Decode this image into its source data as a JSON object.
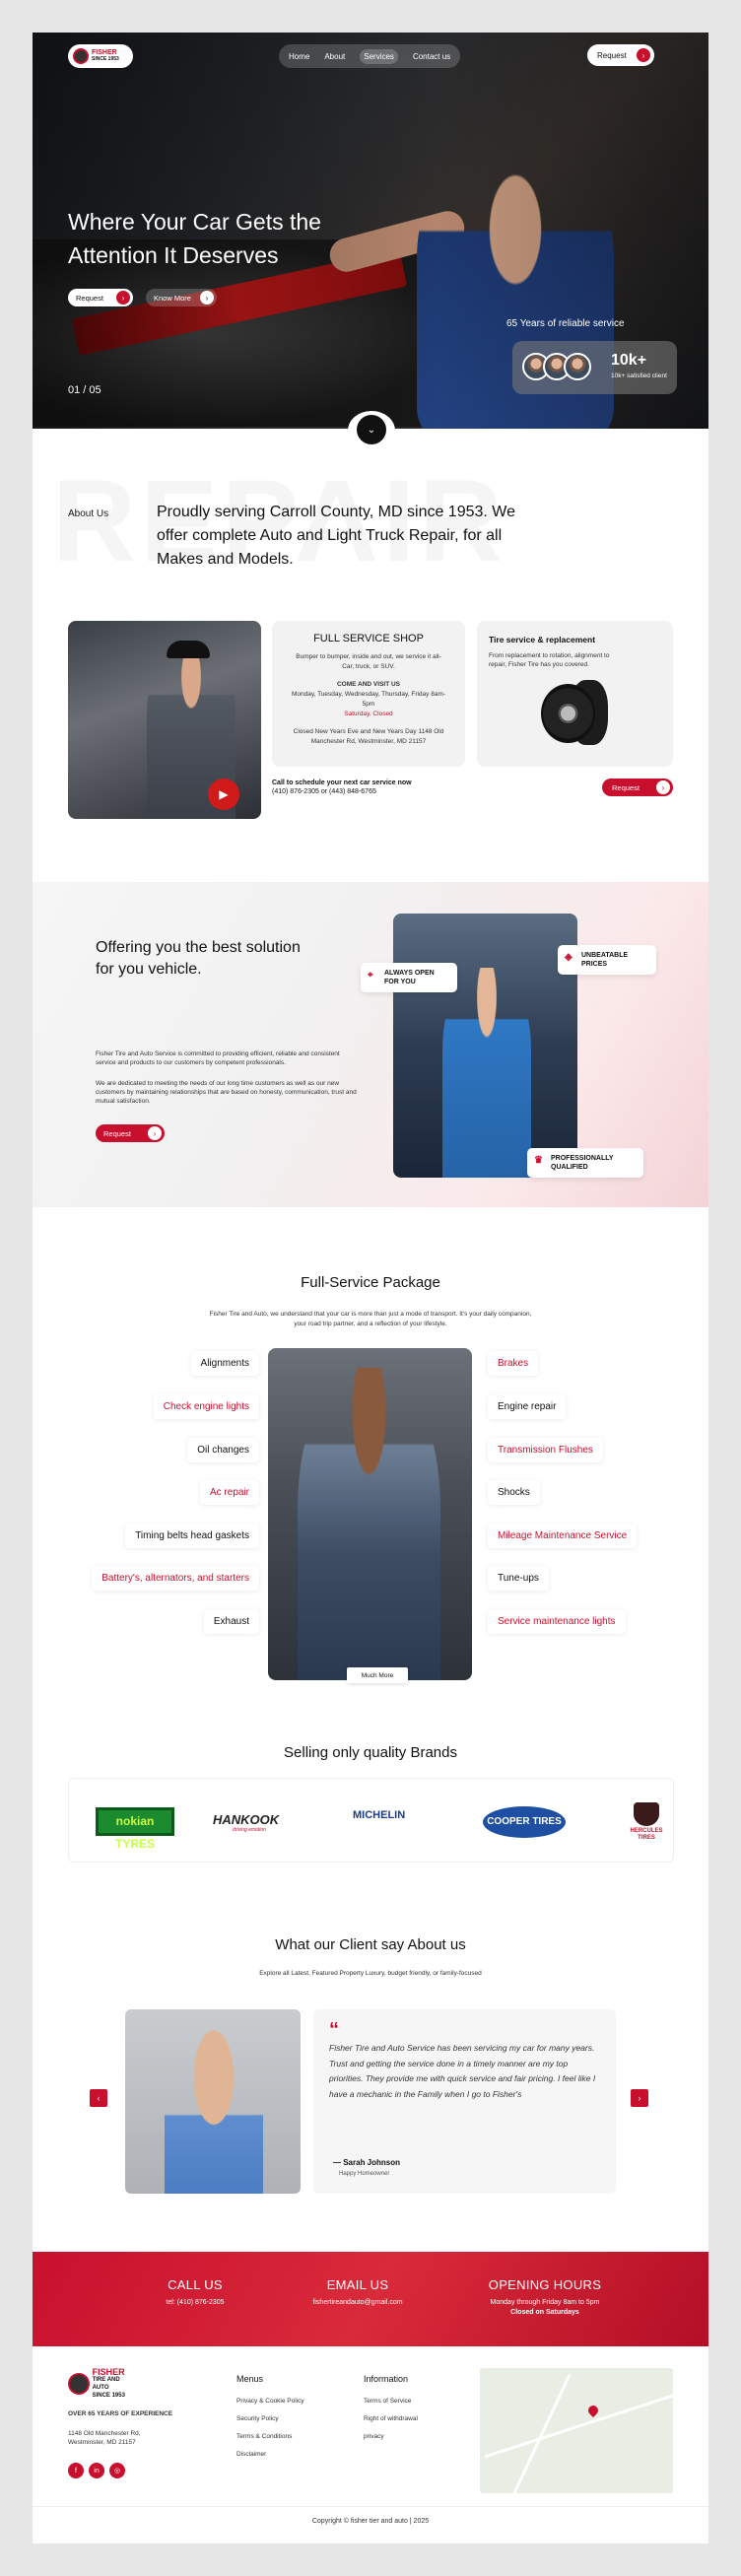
{
  "brand": {
    "name": "FISHER",
    "sub": "TIRE AND AUTO",
    "since": "SINCE 1953"
  },
  "nav": {
    "items": [
      "Home",
      "About",
      "Services",
      "Contact us"
    ],
    "request_label": "Request"
  },
  "hero": {
    "headline": "Where Your Car Gets the Attention It Deserves",
    "request_label": "Request",
    "know_more_label": "Know More",
    "slide_current": "01",
    "slide_total": "05",
    "years_text": "65 Years of reliable service",
    "stat_value": "10k+",
    "stat_label": "10k+ satisfied client"
  },
  "about": {
    "bg_word": "REPAIR",
    "label": "About Us",
    "text": "Proudly serving Carroll County, MD since 1953. We offer complete Auto and Light Truck Repair, for all Makes and Models."
  },
  "shop_card": {
    "title": "FULL SERVICE SHOP",
    "desc": "Bumper to bumper, inside and out, we service it all- Car, truck, or SUV.",
    "visit_heading": "COME AND VISIT US",
    "hours": "Monday, Tuesday, Wednesday, Thursday, Friday 8am-5pm",
    "saturday": "Saturday, Closed",
    "closed_note": "Closed New Years Eve and New Years Day 1148 Old Manchester Rd, Westminster, MD 21157"
  },
  "schedule": {
    "heading": "Call to schedule your next car service now",
    "phones": "(410) 876-2305 or (443) 848-6765"
  },
  "tire_card": {
    "title": "Tire service & replacement",
    "desc": "From replacement to rotation, alignment to repair, Fisher Tire has you covered.",
    "request_label": "Request"
  },
  "offer": {
    "title": "Offering you the best solution for you vehicle.",
    "p1": "Fisher Tire and Auto Service is committed to providing efficient, reliable and consistent service and products to our customers by competent professionals.",
    "p2": "We are dedicated to meeting the needs of our long time customers as well as our new customers by maintaining relationships that are based on honesty, communication, trust and mutual satisfaction.",
    "request_label": "Request",
    "badges": [
      "ALWAYS OPEN FOR YOU",
      "UNBEATABLE PRICES",
      "PROFESSIONALLY QUALIFIED"
    ]
  },
  "package": {
    "title": "Full-Service Package",
    "subtitle": "Fisher Tire and Auto, we understand that your car is more than just a mode of transport. It's your daily companion, your road trip partner, and a reflection of your lifestyle.",
    "left": [
      "Alignments",
      "Check engine lights",
      "Oil changes",
      "Ac repair",
      "Timing belts head gaskets",
      "Battery's, alternators, and starters",
      "Exhaust"
    ],
    "right": [
      "Brakes",
      "Engine repair",
      "Transmission Flushes",
      "Shocks",
      "Mileage Maintenance Service",
      "Tune-ups",
      "Service maintenance lights"
    ],
    "more_label": "Much More"
  },
  "brands": {
    "title": "Selling only quality Brands",
    "items": [
      "nokian TYRES",
      "HANKOOK",
      "MICHELIN",
      "COOPER TIRES",
      "HERCULES TIRES"
    ],
    "hankook_tag": "driving emotion"
  },
  "testimonial": {
    "title": "What our Client say About us",
    "subtitle": "Explore all Latest, Featured Property Luxury, budget friendly, or family-focused",
    "quote_mark": "“",
    "text": "Fisher Tire and Auto Service has been servicing my car for many years. Trust and getting the service done in a timely manner are my top priorities. They provide me with quick service and fair pricing. I feel like I have a mechanic in the Family when I go to Fisher's",
    "name": "— Sarah Johnson",
    "role": "Happy Homeowner"
  },
  "contact": {
    "call_title": "CALL US",
    "call_value": "tel: (410) 876-2305",
    "email_title": "EMAIL US",
    "email_value": "fishertireandauto@gmail.com",
    "hours_title": "OPENING HOURS",
    "hours_value": "Monday through Friday 8am to 5pm",
    "hours_value2": "Closed on Saturdays"
  },
  "footer": {
    "tagline": "OVER 65 YEARS OF EXPERIENCE",
    "address": "1148 Old Manchester Rd, Westminster, MD 21157",
    "menus_title": "Menus",
    "menus": [
      "Privacy & Cookie Policy",
      "Security Policy",
      "Terms & Conditions",
      "Disclaimer"
    ],
    "info_title": "Information",
    "info": [
      "Terms of Service",
      "Right of withdrawal",
      "privacy"
    ],
    "copyright": "Copyright © fisher tier and auto  |  2025"
  },
  "colors": {
    "accent": "#c8102e",
    "dark": "#111111"
  },
  "icons": {
    "arrow": "arrow-right-icon",
    "play": "play-icon",
    "scroll": "chevron-down-icon"
  }
}
